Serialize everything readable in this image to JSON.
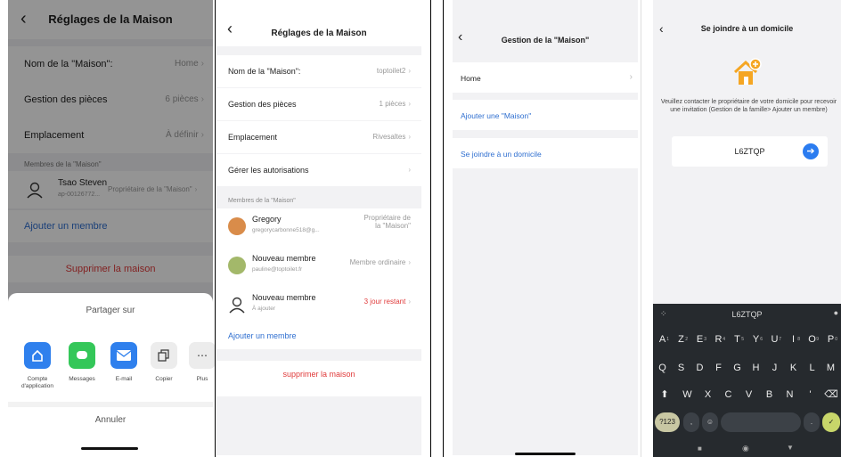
{
  "screen1": {
    "title": "Réglages de la Maison",
    "rows": [
      {
        "label": "Nom de la \"Maison\":",
        "value": "Home"
      },
      {
        "label": "Gestion des pièces",
        "value": "6 pièces"
      },
      {
        "label": "Emplacement",
        "value": "À définir"
      }
    ],
    "members_section": "Membres de la \"Maison\"",
    "member": {
      "name": "Tsao Steven",
      "sub": "ap-00126772...",
      "role": "Propriétaire de la \"Maison\""
    },
    "add_member": "Ajouter un membre",
    "delete_home": "Supprimer la maison",
    "share_sheet": {
      "title": "Partager sur",
      "items": [
        {
          "label": "Compte d'application",
          "icon": "home-app-icon",
          "color": "#2f80ed"
        },
        {
          "label": "Messages",
          "icon": "messages-icon",
          "color": "#34c759"
        },
        {
          "label": "E-mail",
          "icon": "mail-icon",
          "color": "#2f80ed"
        },
        {
          "label": "Copier",
          "icon": "copy-icon",
          "color": "#ececec"
        },
        {
          "label": "Plus",
          "icon": "more-icon",
          "color": "#ececec"
        }
      ],
      "cancel": "Annuler"
    }
  },
  "screen2": {
    "title": "Réglages de la Maison",
    "rows": [
      {
        "label": "Nom de la \"Maison\":",
        "value": "toptoilet2"
      },
      {
        "label": "Gestion des pièces",
        "value": "1 pièces"
      },
      {
        "label": "Emplacement",
        "value": "Rivesaltes"
      },
      {
        "label": "Gérer les autorisations",
        "value": ""
      }
    ],
    "members_section": "Membres de la \"Maison\"",
    "members": [
      {
        "name": "Gregory",
        "sub": "gregorycarbonne518@g...",
        "role": "Propriétaire de la \"Maison\""
      },
      {
        "name": "Nouveau membre",
        "sub": "pauline@toptoilet.fr",
        "role": "Membre ordinaire"
      },
      {
        "name": "Nouveau membre",
        "sub": "À ajouter",
        "role": "3 jour restant"
      }
    ],
    "add_member": "Ajouter un membre",
    "delete_home": "supprimer la maison"
  },
  "screen3": {
    "title": "Gestion de la \"Maison\"",
    "home_item": "Home",
    "add_home": "Ajouter une \"Maison\"",
    "join_home": "Se joindre à un domicile"
  },
  "screen4": {
    "title": "Se joindre à un domicile",
    "description": "Veuillez contacter le propriétaire de votre domicile pour recevoir une invitation (Gestion de la famille> Ajouter un membre)",
    "code": "L6ZTQP",
    "keyboard": {
      "suggestion": "L6ZTQP",
      "row1": [
        "A",
        "Z",
        "E",
        "R",
        "T",
        "Y",
        "U",
        "I",
        "O",
        "P"
      ],
      "row1_sup": [
        "1",
        "2",
        "3",
        "4",
        "5",
        "6",
        "7",
        "8",
        "9",
        "0"
      ],
      "row2": [
        "Q",
        "S",
        "D",
        "F",
        "G",
        "H",
        "J",
        "K",
        "L",
        "M"
      ],
      "row3": [
        "W",
        "X",
        "C",
        "V",
        "B",
        "N",
        "'"
      ],
      "num_key": "?123",
      "comma": ",",
      "period": "."
    },
    "accent_color": "#f5a623"
  }
}
